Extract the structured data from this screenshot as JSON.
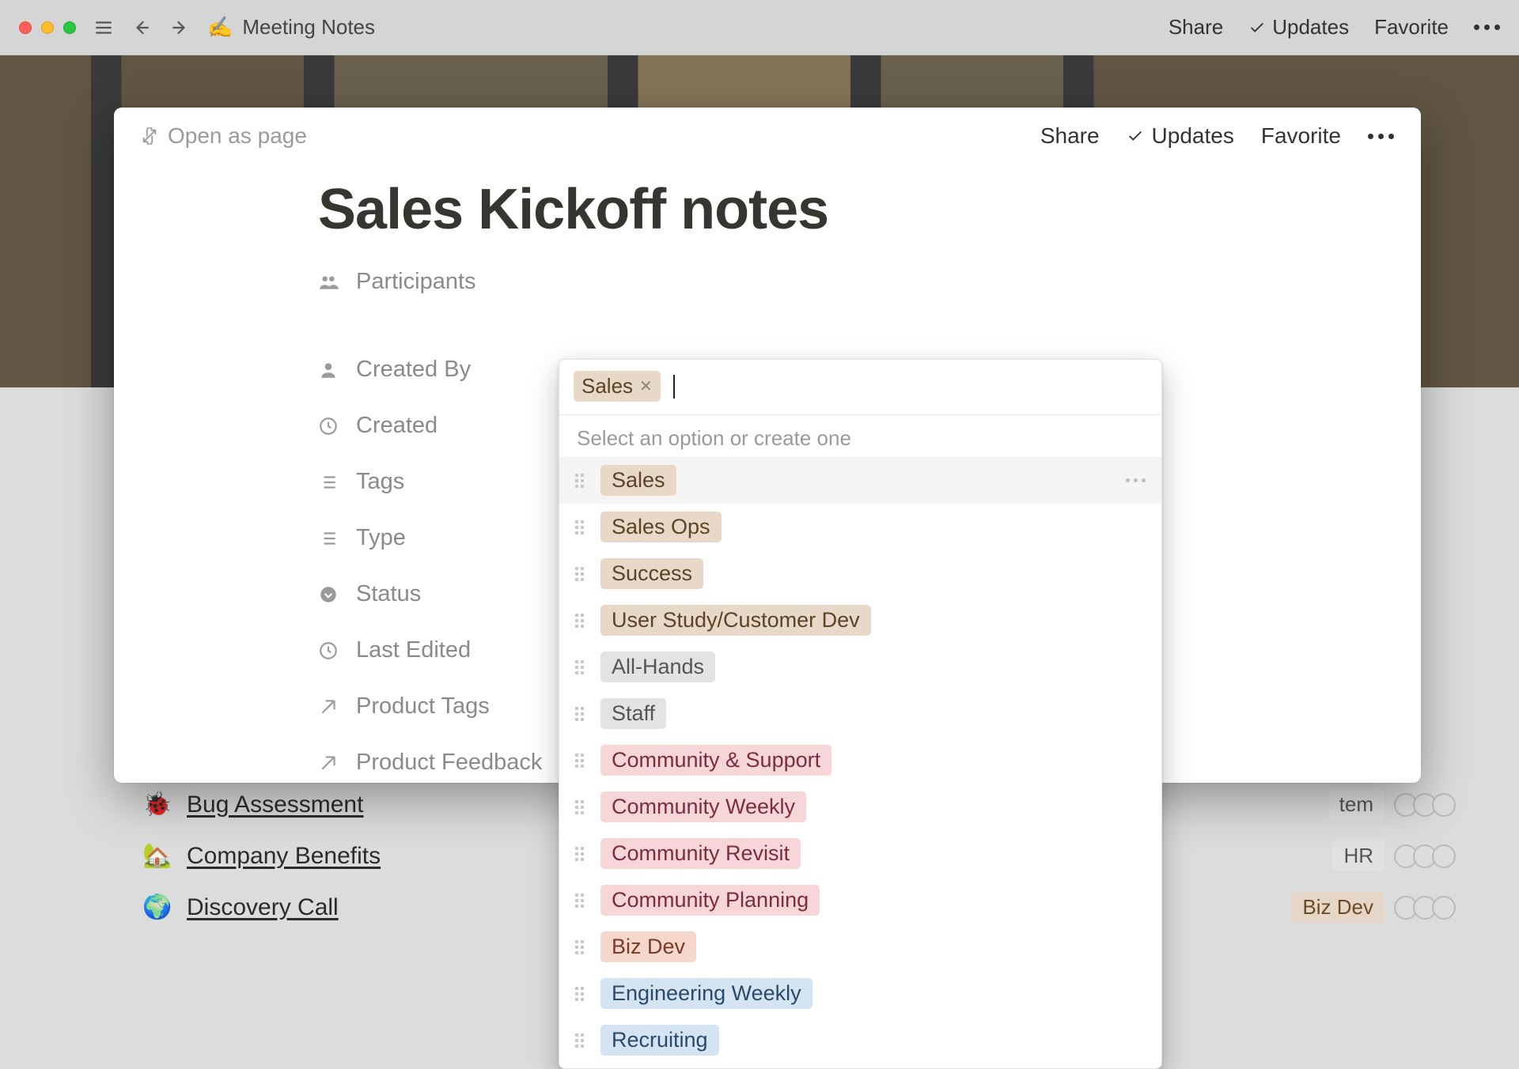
{
  "toolbar": {
    "icon": "✍️",
    "breadcrumb": "Meeting Notes",
    "share": "Share",
    "updates": "Updates",
    "favorite": "Favorite"
  },
  "modal": {
    "open_as_page": "Open as page",
    "share": "Share",
    "updates": "Updates",
    "favorite": "Favorite",
    "title": "Sales Kickoff notes",
    "properties": [
      {
        "icon": "participants",
        "label": "Participants"
      },
      {
        "icon": "person",
        "label": "Created By"
      },
      {
        "icon": "clock",
        "label": "Created"
      },
      {
        "icon": "list",
        "label": "Tags"
      },
      {
        "icon": "list",
        "label": "Type"
      },
      {
        "icon": "status",
        "label": "Status"
      },
      {
        "icon": "clock",
        "label": "Last Edited"
      },
      {
        "icon": "arrow",
        "label": "Product Tags"
      },
      {
        "icon": "arrow",
        "label": "Product Feedback"
      }
    ]
  },
  "select": {
    "selected_chip": "Sales",
    "hint": "Select an option or create one",
    "options": [
      {
        "label": "Sales",
        "color": "c-brown",
        "hovered": true
      },
      {
        "label": "Sales Ops",
        "color": "c-brown",
        "hovered": false
      },
      {
        "label": "Success",
        "color": "c-brown",
        "hovered": false
      },
      {
        "label": "User Study/Customer Dev",
        "color": "c-brown",
        "hovered": false
      },
      {
        "label": "All-Hands",
        "color": "c-gray",
        "hovered": false
      },
      {
        "label": "Staff",
        "color": "c-gray",
        "hovered": false
      },
      {
        "label": "Community & Support",
        "color": "c-pink",
        "hovered": false
      },
      {
        "label": "Community Weekly",
        "color": "c-pink",
        "hovered": false
      },
      {
        "label": "Community Revisit",
        "color": "c-pink",
        "hovered": false
      },
      {
        "label": "Community Planning",
        "color": "c-pink",
        "hovered": false
      },
      {
        "label": "Biz Dev",
        "color": "c-salmon",
        "hovered": false
      },
      {
        "label": "Engineering Weekly",
        "color": "c-blue",
        "hovered": false
      },
      {
        "label": "Recruiting",
        "color": "c-blue",
        "hovered": false
      }
    ]
  },
  "behind": {
    "rows": [
      {
        "emoji": "🐞",
        "title": "Bug Assessment",
        "pill": "tem",
        "pill_color": "pill gray"
      },
      {
        "emoji": "🏡",
        "title": "Company Benefits",
        "pill": "HR",
        "pill_color": "pill gray"
      },
      {
        "emoji": "🌍",
        "title": "Discovery Call",
        "pill": "Biz Dev",
        "pill_color": "pill brown"
      }
    ]
  }
}
